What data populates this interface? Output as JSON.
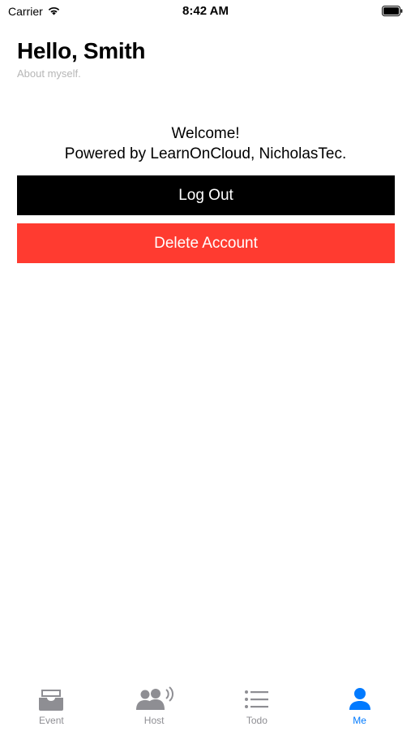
{
  "status_bar": {
    "carrier": "Carrier",
    "time": "8:42 AM",
    "icons": [
      "wifi-icon",
      "battery-icon"
    ]
  },
  "header": {
    "title": "Hello, Smith",
    "subtitle": "About myself."
  },
  "content": {
    "welcome_line1": "Welcome!",
    "welcome_line2": "Powered by LearnOnCloud, NicholasTec."
  },
  "buttons": {
    "logout_label": "Log Out",
    "delete_label": "Delete Account"
  },
  "tabs": [
    {
      "label": "Event",
      "icon": "tray-icon",
      "active": false
    },
    {
      "label": "Host",
      "icon": "people-broadcast-icon",
      "active": false
    },
    {
      "label": "Todo",
      "icon": "list-icon",
      "active": false
    },
    {
      "label": "Me",
      "icon": "person-icon",
      "active": true
    }
  ],
  "colors": {
    "accent": "#007aff",
    "danger": "#ff3b30",
    "primary_button": "#000000",
    "inactive_tab": "#8e8e93",
    "subtitle": "#b6b6b6"
  }
}
